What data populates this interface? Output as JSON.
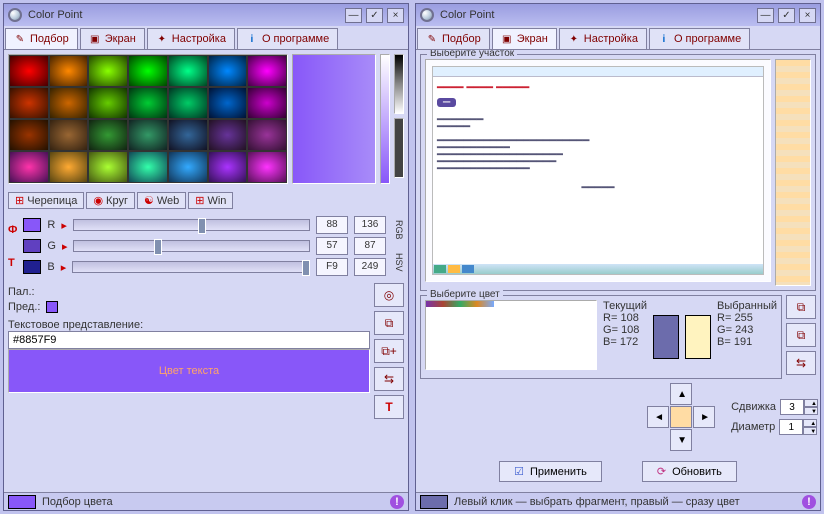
{
  "leftWindow": {
    "title": "Color Point",
    "tabs": [
      "Подбор",
      "Экран",
      "Настройка",
      "О программе"
    ],
    "activeTab": 0,
    "subtabs": [
      "Черепица",
      "Круг",
      "Web",
      "Win"
    ],
    "channels": {
      "R": {
        "label": "R",
        "dec": 88,
        "hex": 136
      },
      "G": {
        "label": "G",
        "dec": 57,
        "hex": 87
      },
      "B": {
        "label": "B",
        "dec": "F9",
        "hex": 249
      }
    },
    "axisLabels": {
      "rgb": "RGB",
      "hsv": "HSV",
      "fLabel": "Ф",
      "tLabel": "Т"
    },
    "palLabel": "Пал.:",
    "predLabel": "Пред.:",
    "reprLabel": "Текстовое представление:",
    "reprValue": "#8857F9",
    "sampleText": "Цвет текста",
    "status": "Подбор цвета"
  },
  "rightWindow": {
    "title": "Color Point",
    "tabs": [
      "Подбор",
      "Экран",
      "Настройка",
      "О программе"
    ],
    "activeTab": 1,
    "selectArea": "Выберите участок",
    "selectColor": "Выберите цвет",
    "currentLabel": "Текущий",
    "selectedLabel": "Выбранный",
    "current": {
      "R": 108,
      "G": 108,
      "B": 172
    },
    "selected": {
      "R": 255,
      "G": 243,
      "B": 191
    },
    "shiftLabel": "Сдвижка",
    "shiftVal": 3,
    "diamLabel": "Диаметр",
    "diamVal": 1,
    "applyLabel": "Применить",
    "refreshLabel": "Обновить",
    "status": "Левый клик — выбрать фрагмент, правый — сразу цвет"
  }
}
